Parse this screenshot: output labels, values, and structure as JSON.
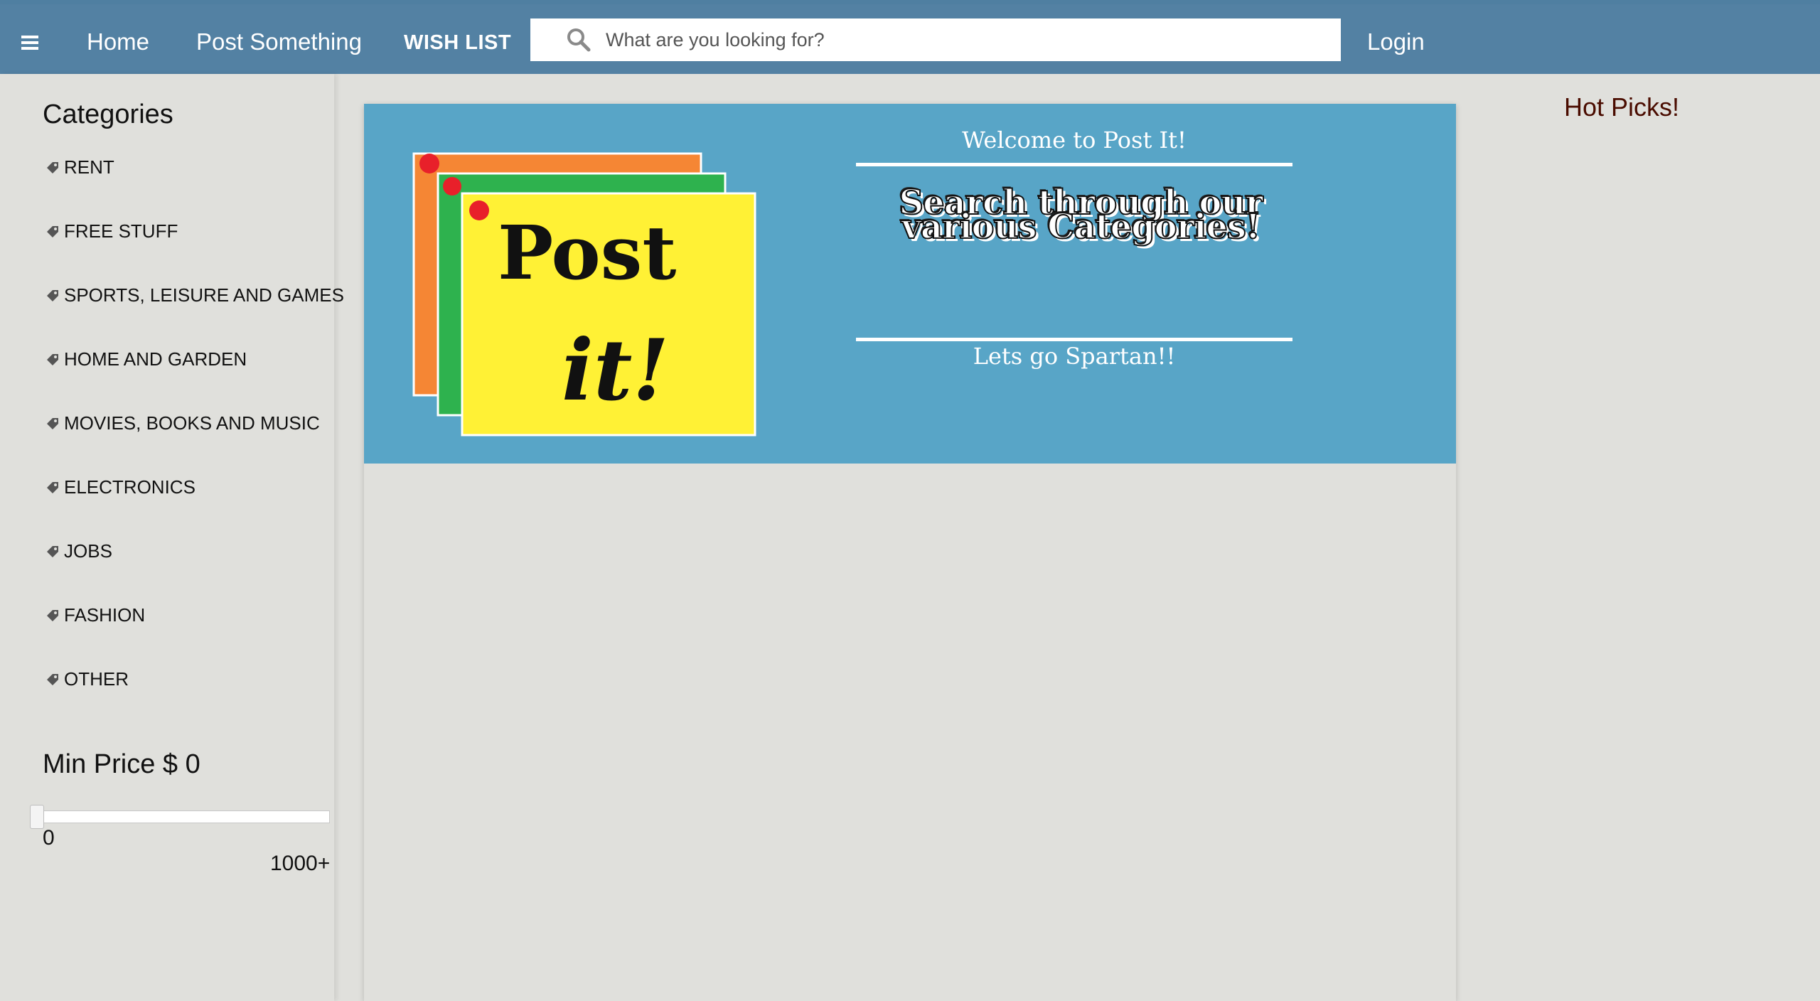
{
  "header": {
    "home_label": "Home",
    "post_label": "Post Something",
    "wishlist_label": "WISH LIST",
    "search_placeholder": "What are you looking for?",
    "login_label": "Login"
  },
  "sidebar": {
    "title": "Categories",
    "categories": [
      {
        "label": "RENT"
      },
      {
        "label": "FREE STUFF"
      },
      {
        "label": "SPORTS, LEISURE AND GAMES"
      },
      {
        "label": "HOME AND GARDEN"
      },
      {
        "label": "MOVIES, BOOKS AND MUSIC"
      },
      {
        "label": "ELECTRONICS"
      },
      {
        "label": "JOBS"
      },
      {
        "label": "FASHION"
      },
      {
        "label": "OTHER"
      }
    ],
    "price": {
      "title": "Min Price $ 0",
      "min_label": "0",
      "max_label": "1000+",
      "value": 0
    }
  },
  "banner": {
    "logo_text_line1": "Post",
    "logo_text_line2": "it!",
    "welcome": "Welcome to Post It!",
    "tagline": "Search through our various Categories!",
    "spartan": "Lets go Spartan!!"
  },
  "right": {
    "hot_picks": "Hot Picks!"
  },
  "colors": {
    "topbar": "#5381a3",
    "banner": "#58a5c7",
    "background": "#e0e0dc",
    "hot_picks": "#4a0c00",
    "note_orange": "#f58634",
    "note_green": "#2eb24e",
    "note_yellow": "#fff135",
    "pin_red": "#e8202a"
  },
  "icons": {
    "menu": "hamburger-icon",
    "search": "search-icon",
    "category": "tag-icon"
  }
}
